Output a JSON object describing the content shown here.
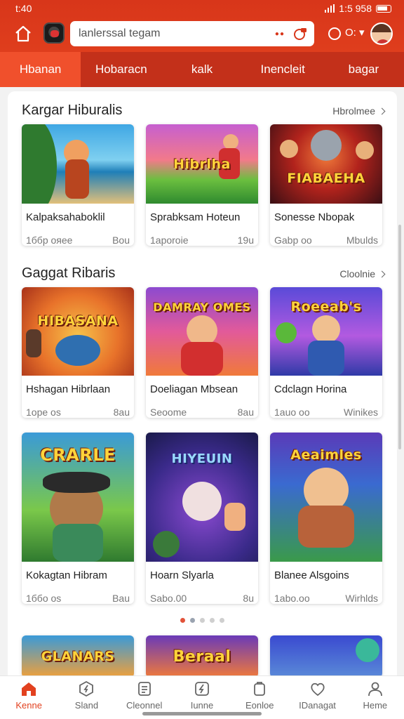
{
  "status": {
    "time": "t:40",
    "indicators": "1:5 958"
  },
  "header": {
    "search_placeholder": "lanlerssal tegam",
    "profile_text": "O: ▾"
  },
  "tabs": [
    {
      "label": "Hbanan",
      "active": true
    },
    {
      "label": "Hobaracn",
      "active": false
    },
    {
      "label": "kalk",
      "active": false
    },
    {
      "label": "Inencleit",
      "active": false
    },
    {
      "label": "bagar",
      "active": false
    }
  ],
  "sections": [
    {
      "title": "Kargar Hiburalis",
      "see_all": "Hbrolmee",
      "cards": [
        {
          "title": "Kalpaksahaboklil",
          "meta_left": "1ббр ояее",
          "meta_right": "Bou",
          "logo": ""
        },
        {
          "title": "Sprabksam Hoteun",
          "meta_left": "1aporoie",
          "meta_right": "19u",
          "logo": "Hibrlha"
        },
        {
          "title": "Sonesse Nbopak",
          "meta_left": "Gabp oo",
          "meta_right": "Mbulds",
          "logo": "FIABAEHA"
        }
      ]
    },
    {
      "title": "Gaggat Ribaris",
      "see_all": "Cloolnie",
      "cards": [
        {
          "title": "Hshagan Hibrlaan",
          "meta_left": "1ope os",
          "meta_right": "8au",
          "logo": "HIBASANA"
        },
        {
          "title": "Doeliagan Mbsean",
          "meta_left": "Seoome",
          "meta_right": "8au",
          "logo": "DAMRAY OMES"
        },
        {
          "title": "Cdclagn Horina",
          "meta_left": "1auo oo",
          "meta_right": "Winikes",
          "logo": "Roeeab's"
        },
        {
          "title": "Kokagtan Hibram",
          "meta_left": "1ббо os",
          "meta_right": "Bau",
          "logo": "CRARLE"
        },
        {
          "title": "Hoarn Slyarla",
          "meta_left": "Sabo.00",
          "meta_right": "8u",
          "logo": "HIYEUIN"
        },
        {
          "title": "Blanee Alsgoins",
          "meta_left": "1abo.oo",
          "meta_right": "Wirhlds",
          "logo": "Aeaimles"
        }
      ]
    }
  ],
  "partial_cards": [
    {
      "logo": "GLANARS"
    },
    {
      "logo": "Beraal"
    },
    {
      "logo": ""
    }
  ],
  "bottom_nav": [
    {
      "label": "Kenne",
      "icon": "home-icon",
      "active": true
    },
    {
      "label": "Sland",
      "icon": "compass-icon",
      "active": false
    },
    {
      "label": "Cleonnel",
      "icon": "list-icon",
      "active": false
    },
    {
      "label": "Iunne",
      "icon": "lightning-icon",
      "active": false
    },
    {
      "label": "Eonloe",
      "icon": "bag-icon",
      "active": false
    },
    {
      "label": "IDanagat",
      "icon": "heart-icon",
      "active": false
    },
    {
      "label": "Heme",
      "icon": "user-icon",
      "active": false
    }
  ],
  "colors": {
    "brand": "#d8361a",
    "tab_bar": "#c3301a",
    "active_tab": "#f0502c",
    "accent_text": "#e2411f"
  }
}
